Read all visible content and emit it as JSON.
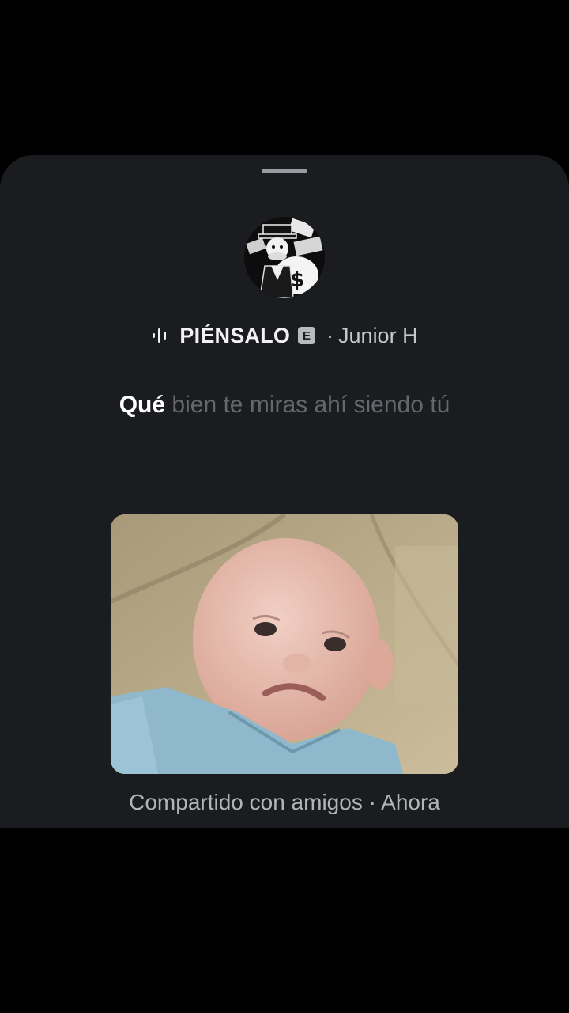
{
  "sheet": {
    "song": {
      "icon": "sound-wave-icon",
      "title": "PIÉNSALO",
      "explicit_badge": "E",
      "separator": "·",
      "artist": "Junior H"
    },
    "lyric": {
      "active_word": "Qué",
      "rest": "bien te miras ahí siendo tú"
    },
    "caption": {
      "text": "Compartido con amigos · Ahora"
    }
  },
  "colors": {
    "sheet_background": "#1b1c20",
    "screen_background": "#000000",
    "lyric_active": "#ffffff",
    "lyric_inactive": "#66676c"
  }
}
